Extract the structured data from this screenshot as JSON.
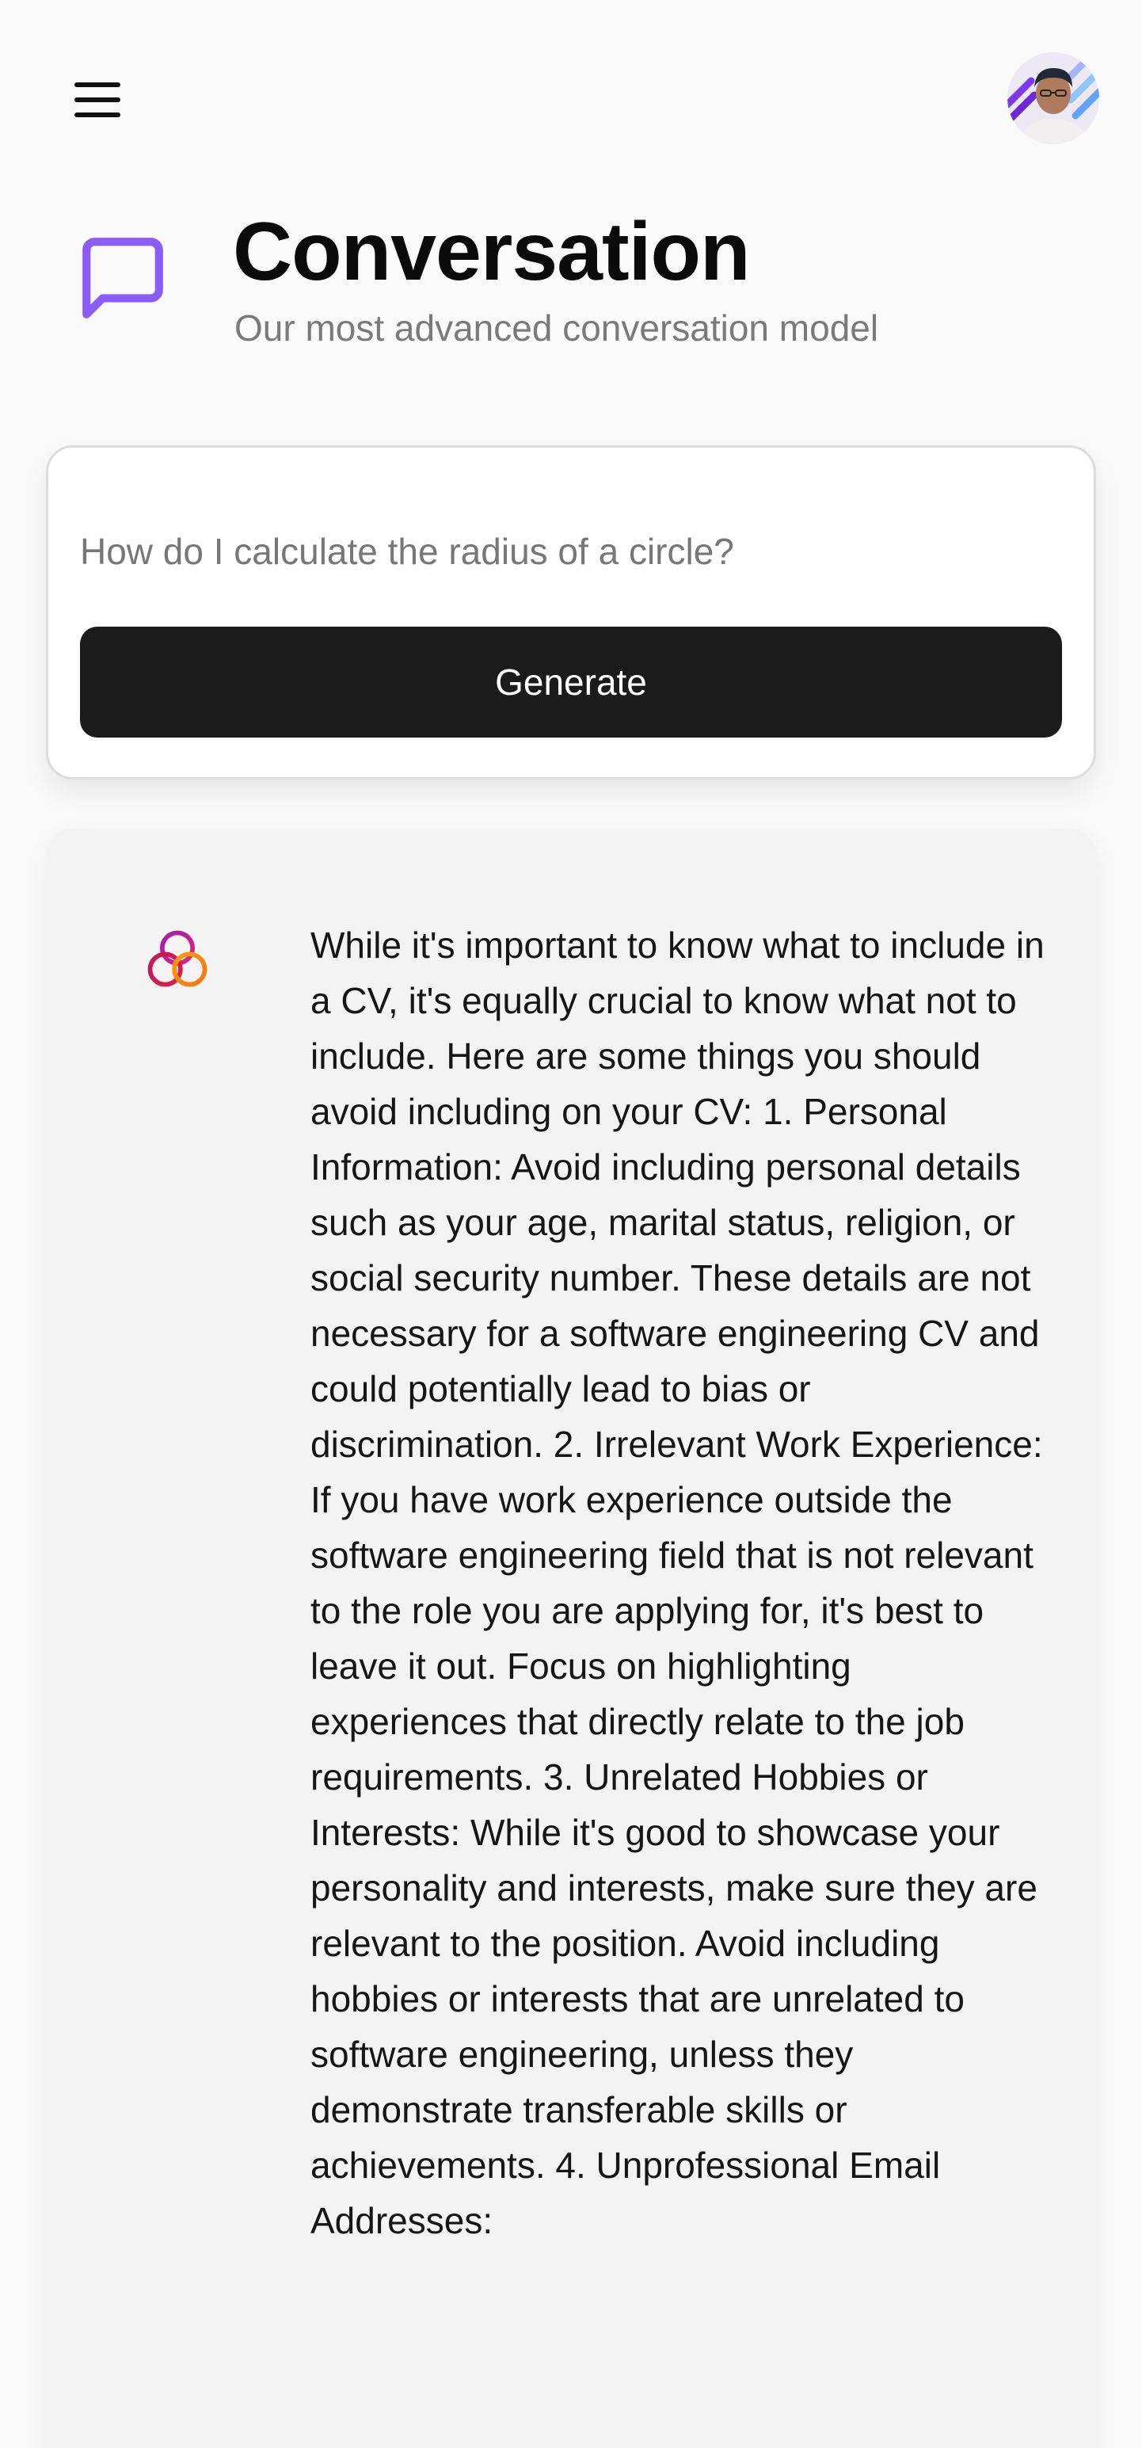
{
  "topbar": {
    "menu_icon": "hamburger-menu-icon",
    "avatar_icon": "user-avatar"
  },
  "header": {
    "icon": "message-square-icon",
    "title": "Conversation",
    "subtitle": "Our most advanced conversation model"
  },
  "prompt": {
    "placeholder": "How do I calculate the radius of a circle?",
    "value": "",
    "generate_label": "Generate"
  },
  "response": {
    "logo_icon": "model-logo-icon",
    "text": "While it's important to know what to include in a CV, it's equally crucial to know what not to include. Here are some things you should avoid including on your CV: 1. Personal Information: Avoid including personal details such as your age, marital status, religion, or social security number. These details are not necessary for a software engineering CV and could potentially lead to bias or discrimination. 2. Irrelevant Work Experience: If you have work experience outside the software engineering field that is not relevant to the role you are applying for, it's best to leave it out. Focus on highlighting experiences that directly relate to the job requirements. 3. Unrelated Hobbies or Interests: While it's good to showcase your personality and interests, make sure they are relevant to the position. Avoid including hobbies or interests that are unrelated to software engineering, unless they demonstrate transferable skills or achievements. 4. Unprofessional Email Addresses:"
  },
  "colors": {
    "accent": "#8b5cf6",
    "button_bg": "#1b1b1b",
    "card_bg": "#f3f3f4"
  }
}
